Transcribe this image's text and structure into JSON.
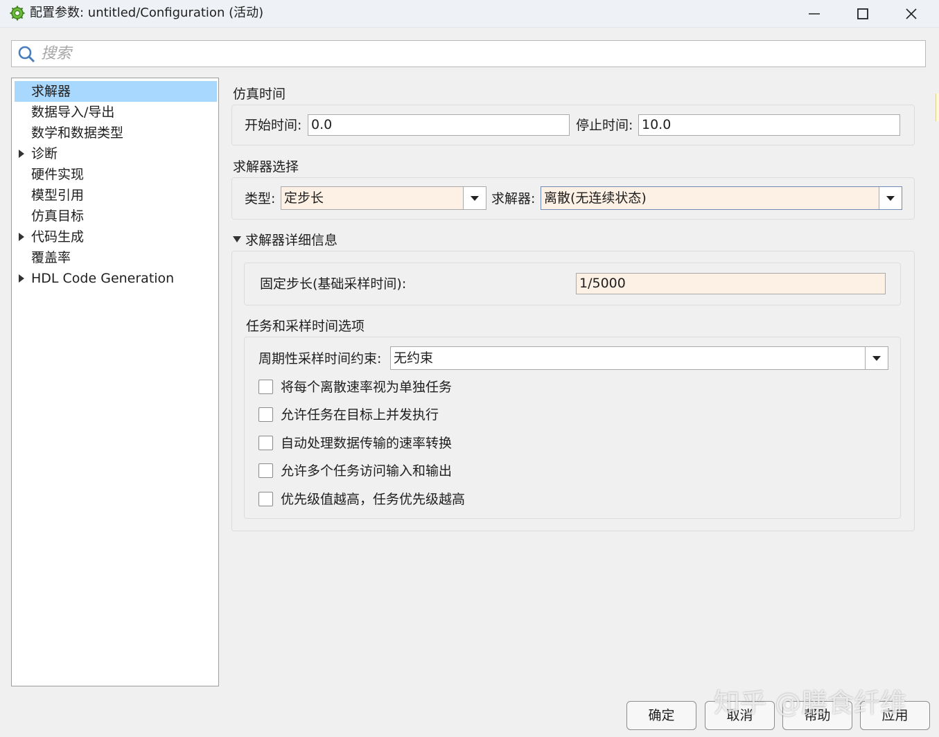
{
  "window": {
    "title": "配置参数: untitled/Configuration (活动)",
    "controls": {
      "minimize": "minimize-icon",
      "maximize": "maximize-icon",
      "close": "close-icon"
    }
  },
  "search": {
    "placeholder": "搜索",
    "value": ""
  },
  "tree": {
    "items": [
      {
        "label": "求解器",
        "expandable": false,
        "selected": true
      },
      {
        "label": "数据导入/导出",
        "expandable": false
      },
      {
        "label": "数学和数据类型",
        "expandable": false
      },
      {
        "label": "诊断",
        "expandable": true
      },
      {
        "label": "硬件实现",
        "expandable": false
      },
      {
        "label": "模型引用",
        "expandable": false
      },
      {
        "label": "仿真目标",
        "expandable": false
      },
      {
        "label": "代码生成",
        "expandable": true
      },
      {
        "label": "覆盖率",
        "expandable": false
      },
      {
        "label": "HDL Code Generation",
        "expandable": true
      }
    ]
  },
  "sim_time": {
    "title": "仿真时间",
    "start_label": "开始时间:",
    "start_value": "0.0",
    "stop_label": "停止时间:",
    "stop_value": "10.0"
  },
  "solver_select": {
    "title": "求解器选择",
    "type_label": "类型:",
    "type_value": "定步长",
    "solver_label": "求解器:",
    "solver_value": "离散(无连续状态)"
  },
  "solver_details": {
    "title": "求解器详细信息",
    "fixed_step_label": "固定步长(基础采样时间):",
    "fixed_step_value": "1/5000"
  },
  "tasking": {
    "title": "任务和采样时间选项",
    "constraint_label": "周期性采样时间约束:",
    "constraint_value": "无约束",
    "options": [
      {
        "label": "将每个离散速率视为单独任务",
        "checked": false
      },
      {
        "label": "允许任务在目标上并发执行",
        "checked": false
      },
      {
        "label": "自动处理数据传输的速率转换",
        "checked": false
      },
      {
        "label": "允许多个任务访问输入和输出",
        "checked": false
      },
      {
        "label": "优先级值越高，任务优先级越高",
        "checked": false
      }
    ]
  },
  "buttons": {
    "ok": "确定",
    "cancel": "取消",
    "help": "帮助",
    "apply": "应用"
  },
  "watermark": "知乎 @膳食纤维",
  "colors": {
    "selection": "#a8d8fd",
    "tinted_field": "#fdf0e4",
    "background": "#f0f0f0"
  }
}
